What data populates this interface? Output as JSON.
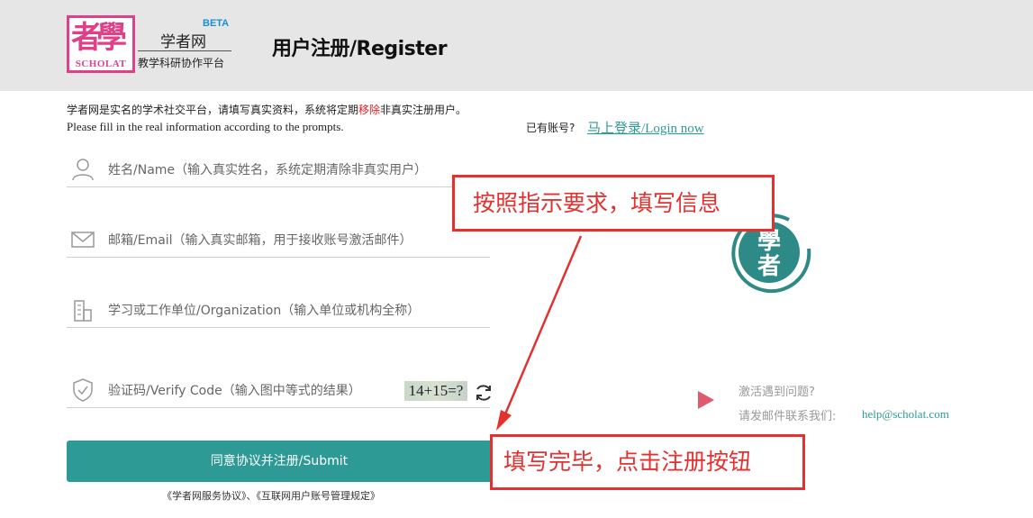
{
  "header": {
    "logo_en": "SCHOLAT",
    "beta": "BETA",
    "site_name": "学者网",
    "slogan": "教学科研协作平台",
    "title": "用户注册/Register"
  },
  "intro": {
    "cn_before": "学者网是实名的学术社交平台，请填写真实资料，系统将定期",
    "cn_highlight": "移除",
    "cn_after": "非真实注册用户。",
    "en": "Please fill in the real information according to the prompts.",
    "has_account": "已有账号?",
    "login_link": "马上登录/Login now"
  },
  "form": {
    "name_placeholder": "姓名/Name（输入真实姓名，系统定期清除非真实用户）",
    "email_placeholder": "邮箱/Email（输入真实邮箱，用于接收账号激活邮件）",
    "org_placeholder": "学习或工作单位/Organization（输入单位或机构全称）",
    "code_placeholder": "验证码/Verify Code（输入图中等式的结果）",
    "captcha_text": "14+15=?",
    "submit_label": "同意协议并注册/Submit",
    "agreements": "《学者网服务协议》、《互联网用户账号管理规定》"
  },
  "help": {
    "title": "激活遇到问题?",
    "text": "请发邮件联系我们:",
    "email": "help@scholat.com"
  },
  "annotations": {
    "callout_1": "按照指示要求，填写信息",
    "callout_2": "填写完毕，点击注册按钮"
  },
  "colors": {
    "accent": "#2e9a95",
    "brand": "#e0408a",
    "warning": "#e53030",
    "header_bg": "#e6e6e6"
  },
  "icons": {
    "name": "user-icon",
    "email": "mail-icon",
    "org": "building-icon",
    "code": "shield-check-icon",
    "refresh": "refresh-icon",
    "help": "play-arrow-icon"
  }
}
